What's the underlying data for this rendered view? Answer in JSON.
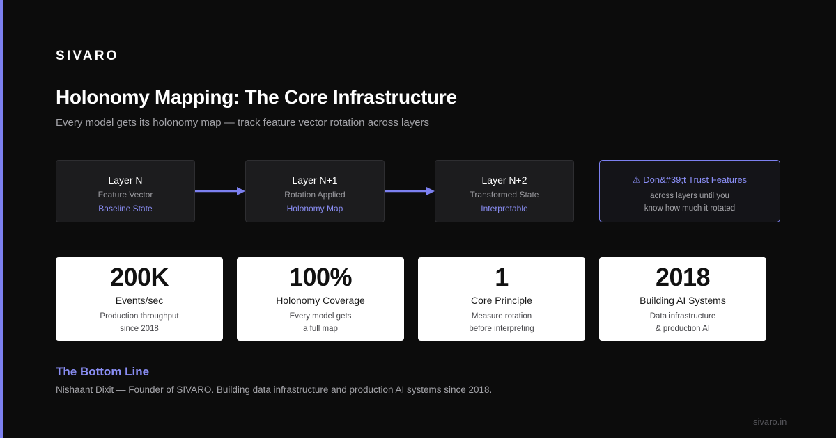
{
  "brand": "SIVARO",
  "title": "Holonomy Mapping: The Core Infrastructure",
  "subtitle": "Every model gets its holonomy map — track feature vector rotation across layers",
  "flow": [
    {
      "name": "Layer N",
      "desc": "Feature Vector",
      "state": "Baseline State"
    },
    {
      "name": "Layer N+1",
      "desc": "Rotation Applied",
      "state": "Holonomy Map"
    },
    {
      "name": "Layer N+2",
      "desc": "Transformed State",
      "state": "Interpretable"
    }
  ],
  "warning": {
    "icon": "warning-icon",
    "symbol": "⚠",
    "title": "Don&#39;t Trust Features",
    "line1": "across layers until you",
    "line2": "know how much it rotated"
  },
  "stats": [
    {
      "value": "200K",
      "label": "Events/sec",
      "line1": "Production throughput",
      "line2": "since 2018"
    },
    {
      "value": "100%",
      "label": "Holonomy Coverage",
      "line1": "Every model gets",
      "line2": "a full map"
    },
    {
      "value": "1",
      "label": "Core Principle",
      "line1": "Measure rotation",
      "line2": "before interpreting"
    },
    {
      "value": "2018",
      "label": "Building AI Systems",
      "line1": "Data infrastructure",
      "line2": "& production AI"
    }
  ],
  "bottom": {
    "title": "The Bottom Line",
    "text": "Nishaant Dixit — Founder of SIVARO. Building data infrastructure and production AI systems since 2018."
  },
  "footer_url": "sivaro.in",
  "colors": {
    "background": "#0c0c0c",
    "accent": "#7c80f0",
    "card": "#ffffff",
    "box": "#1c1c1e"
  }
}
